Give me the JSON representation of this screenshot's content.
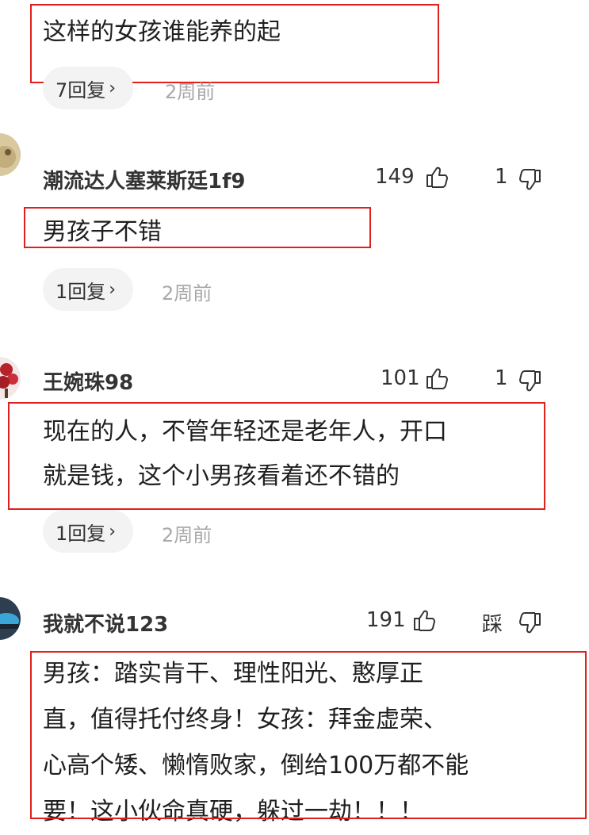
{
  "comments": [
    {
      "text_lines": [
        "这样的女孩谁能养的起"
      ],
      "reply_label": "7回复",
      "time": "2周前"
    },
    {
      "username": "潮流达人塞莱斯廷1f9",
      "likes": "149",
      "dislikes": "1",
      "text_lines": [
        "男孩子不错"
      ],
      "reply_label": "1回复",
      "time": "2周前"
    },
    {
      "username": "王婉珠98",
      "likes": "101",
      "dislikes": "1",
      "text_lines": [
        "现在的人，不管年轻还是老年人，开口",
        "就是钱，这个小男孩看着还不错的"
      ],
      "reply_label": "1回复",
      "time": "2周前"
    },
    {
      "username": "我就不说123",
      "likes": "191",
      "dislikes": "踩",
      "text_lines": [
        "男孩：踏实肯干、理性阳光、憨厚正",
        "直，值得托付终身！女孩：拜金虚荣、",
        "心高个矮、懒惰败家，倒给100万都不能",
        "要！这小伙命真硬，躲过一劫！！！"
      ]
    }
  ],
  "colors": {
    "highlight": "#e0201a",
    "pill_bg": "#f3f3f3",
    "time": "#a8a8a8"
  },
  "icons": [
    "like-icon",
    "dislike-icon",
    "chevron-right-icon"
  ]
}
